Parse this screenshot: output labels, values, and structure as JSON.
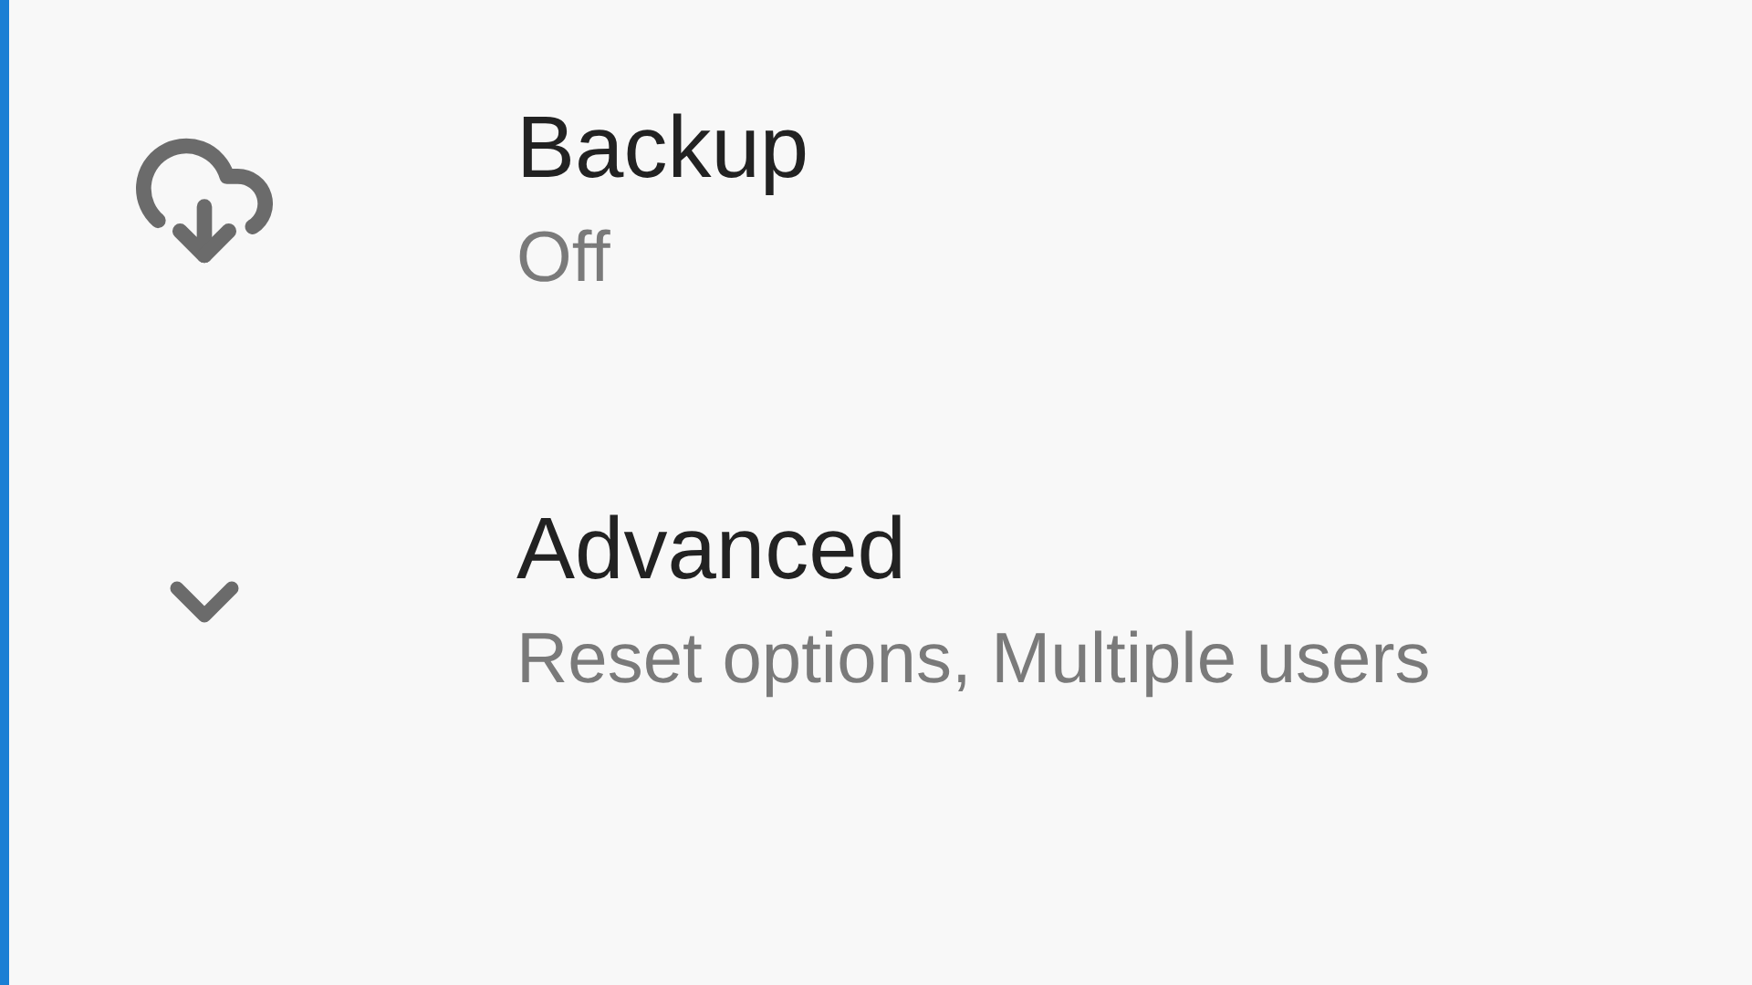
{
  "items": [
    {
      "kind": "backup",
      "title": "Backup",
      "subtitle": "Off"
    },
    {
      "kind": "expand",
      "title": "Advanced",
      "subtitle": "Reset options, Multiple users"
    }
  ]
}
